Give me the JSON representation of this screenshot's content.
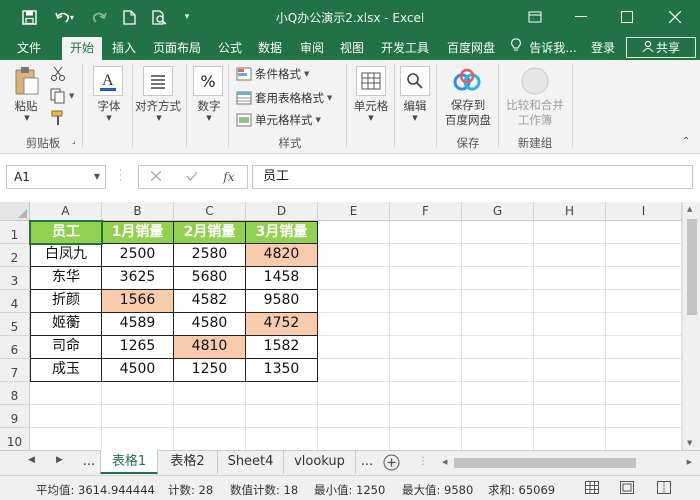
{
  "window": {
    "title": "小Q办公演示2.xlsx  -  Excel"
  },
  "ribbon_tabs": [
    {
      "label": "文件"
    },
    {
      "label": "开始"
    },
    {
      "label": "插入"
    },
    {
      "label": "页面布局"
    },
    {
      "label": "公式"
    },
    {
      "label": "数据"
    },
    {
      "label": "审阅"
    },
    {
      "label": "视图"
    },
    {
      "label": "开发工具"
    },
    {
      "label": "百度网盘"
    },
    {
      "label": "告诉我..."
    },
    {
      "label": "登录"
    }
  ],
  "share_label": "共享",
  "ribbon": {
    "paste_label": "粘贴",
    "clipboard_group": "剪贴板",
    "font_label": "字体",
    "alignment_label": "对齐方式",
    "number_label": "数字",
    "conditional_format": "条件格式",
    "table_format": "套用表格格式",
    "cell_styles": "单元格样式",
    "styles_group": "样式",
    "cells_label": "单元格",
    "editing_label": "编辑",
    "save_baidu_1": "保存到",
    "save_baidu_2": "百度网盘",
    "save_group": "保存",
    "compare_1": "比较和合并",
    "compare_2": "工作簿",
    "new_group": "新建组"
  },
  "formula_bar": {
    "name_box": "A1",
    "content": "员工"
  },
  "columns": [
    "A",
    "B",
    "C",
    "D",
    "E",
    "F",
    "G",
    "H",
    "I"
  ],
  "rows": [
    "1",
    "2",
    "3",
    "4",
    "5",
    "6",
    "7",
    "8",
    "9",
    "10"
  ],
  "table": {
    "headers": [
      "员工",
      "1月销量",
      "2月销量",
      "3月销量"
    ],
    "rows": [
      [
        "白凤九",
        "2500",
        "2580",
        "4820"
      ],
      [
        "东华",
        "3625",
        "5680",
        "1458"
      ],
      [
        "折颜",
        "1566",
        "4582",
        "9580"
      ],
      [
        "姬蘅",
        "4589",
        "4580",
        "4752"
      ],
      [
        "司命",
        "1265",
        "4810",
        "1582"
      ],
      [
        "成玉",
        "4500",
        "1250",
        "1350"
      ]
    ],
    "highlight_color": "#f8cbad",
    "header_color": "#92d050"
  },
  "sheets": [
    "表格1",
    "表格2",
    "Sheet4",
    "vlookup"
  ],
  "sheet_overflow": "...",
  "status": {
    "average": "平均值: 3614.944444",
    "count": "计数: 28",
    "numeric_count": "数值计数: 18",
    "min": "最小值: 1250",
    "max": "最大值: 9580",
    "sum": "求和: 65069"
  },
  "colors": {
    "excel_green": "#217346"
  }
}
